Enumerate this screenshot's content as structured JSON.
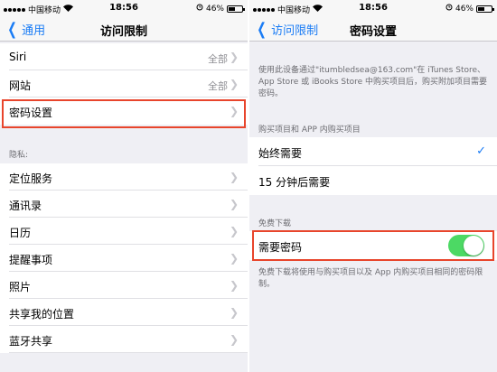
{
  "status": {
    "carrier": "中国移动",
    "time": "18:56",
    "battery": "46%"
  },
  "left": {
    "nav": {
      "back": "通用",
      "title": "访问限制"
    },
    "items": [
      {
        "label": "Siri",
        "value": "全部"
      },
      {
        "label": "网站",
        "value": "全部"
      },
      {
        "label": "密码设置",
        "value": ""
      }
    ],
    "privacy_header": "隐私:",
    "privacy_items": [
      {
        "label": "定位服务"
      },
      {
        "label": "通讯录"
      },
      {
        "label": "日历"
      },
      {
        "label": "提醒事项"
      },
      {
        "label": "照片"
      },
      {
        "label": "共享我的位置"
      },
      {
        "label": "蓝牙共享"
      }
    ]
  },
  "right": {
    "nav": {
      "back": "访问限制",
      "title": "密码设置"
    },
    "description": "使用此设备通过\"itumbledsea@163.com\"在 iTunes Store、App Store 或 iBooks Store 中购买项目后，购买附加项目需要密码。",
    "purchase_header": "购买项目和 APP 内购买项目",
    "purchase_options": [
      {
        "label": "始终需要",
        "checked": true
      },
      {
        "label": "15 分钟后需要",
        "checked": false
      }
    ],
    "free_header": "免费下载",
    "require_password": {
      "label": "需要密码",
      "on": true
    },
    "footnote": "免费下载将使用与购买项目以及 App 内购买项目相同的密码限制。"
  },
  "colors": {
    "accent": "#1a7cf5",
    "highlight": "#e8452c",
    "toggle_on": "#4cd964"
  }
}
